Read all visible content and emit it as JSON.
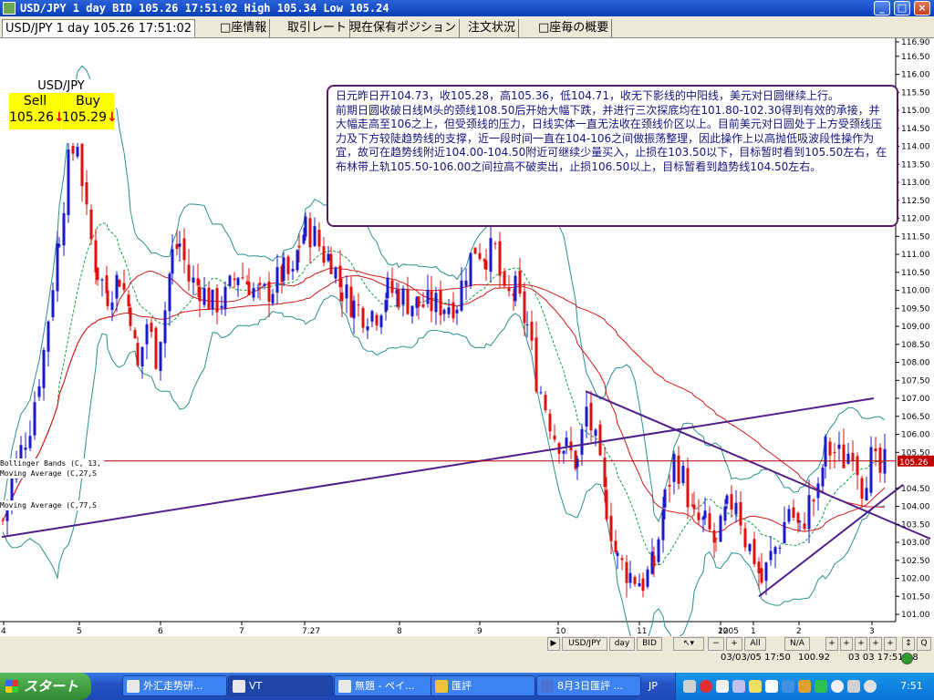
{
  "window": {
    "title": "USD/JPY 1 day BID 105.26 17:51:02 High 105.34 Low 105.24"
  },
  "tabs": [
    {
      "label": "USD/JPY 1 day 105.26 17:51:02"
    },
    {
      "label": "□座情報"
    },
    {
      "label": "取引レート"
    },
    {
      "label": "現在保有ポジション"
    },
    {
      "label": "注文状況"
    },
    {
      "label": "□座毎の概要"
    }
  ],
  "price_box": {
    "pair": "USD/JPY",
    "sell_label": "Sell",
    "sell_value": "105.26",
    "buy_label": "Buy",
    "buy_value": "105.29",
    "arrow": "↓"
  },
  "commentary": {
    "text": "日元昨日开104.73，收105.28，高105.36，低104.71，收无下影线的中阳线，美元对日圆继续上行。\n前期日圆收破日线M头的颈线108.50后开始大幅下跌，并进行三次探底均在101.80-102.30得到有效的承接，并大幅走高至106之上，但受颈线的压力，日线实体一直无法收在颈线价区以上。目前美元对日圆处于上方受颈线压力及下方较陡趋势线的支撑，近一段时间一直在104-106之间做振荡整理，因此操作上以高抛低吸波段性操作为宜，故可在趋势线附近104.00-104.50附近可继续少量买入，止损在103.50以下，目标暂时看到105.50左右，在布林带上轨105.50-106.00之间拉高不破卖出，止损106.50以上，目标暂看到趋势线104.50左右。"
  },
  "indicator_labels": {
    "bollinger": "Bollinger Bands (C, 13,",
    "ma1": "Moving Average (C,27,S",
    "ma2": "Moving Average (C,77,S"
  },
  "colors": {
    "up_candle": "#1a1acc",
    "down_candle": "#e01010",
    "bollinger": "#2a9090",
    "ma_short": "#10a040",
    "ma_long": "#d01818",
    "trendline": "#50208a",
    "neckline": "#b00000"
  },
  "chart_data": {
    "type": "candlestick",
    "y_axis_ticks": [
      "116.90",
      "116.50",
      "116.00",
      "115.50",
      "115.00",
      "114.50",
      "114.00",
      "113.50",
      "113.00",
      "112.50",
      "112.00",
      "111.50",
      "111.00",
      "110.50",
      "110.00",
      "109.50",
      "109.00",
      "108.50",
      "108.00",
      "107.50",
      "107.00",
      "106.50",
      "106.00",
      "105.50",
      "104.50",
      "104.00",
      "103.50",
      "103.00",
      "102.50",
      "102.00",
      "101.50",
      "101.00"
    ],
    "current_price_label": "105.26",
    "ylim": [
      100.9,
      116.9
    ],
    "x_axis_ticks": [
      "4",
      "5",
      "6",
      "7",
      "7.27",
      "8",
      "9",
      "10",
      "11",
      "12",
      "1",
      "2005",
      "2",
      "3"
    ],
    "neckline_value": 105.26
  },
  "bottom_bar": {
    "buttons": [
      "USD/JPY",
      "day",
      "BID",
      "All",
      "N/A"
    ],
    "status_datetime": "03/03/05 17:50",
    "status_price": "100.92",
    "status_time": "03 03 17:51:08"
  },
  "taskbar": {
    "start_label": "スタート",
    "tasks": [
      "外汇走势研...",
      "VT",
      "無題 - ペイ...",
      "匯評",
      "8月3日匯評 ..."
    ],
    "lang": "JP",
    "clock": "7:51"
  }
}
